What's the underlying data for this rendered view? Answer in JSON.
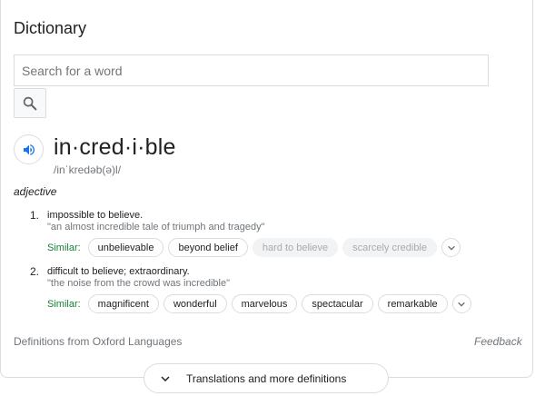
{
  "title": "Dictionary",
  "search": {
    "placeholder": "Search for a word"
  },
  "entry": {
    "word": "in·cred·i·ble",
    "phonetic": "/inˈkredəb(ə)l/",
    "part_of_speech": "adjective",
    "definitions": [
      {
        "number": "1.",
        "text": "impossible to believe.",
        "example": "\"an almost incredible tale of triumph and tragedy\"",
        "similar_label": "Similar:",
        "similar": [
          "unbelievable",
          "beyond belief",
          "hard to believe",
          "scarcely credible"
        ]
      },
      {
        "number": "2.",
        "text": "difficult to believe; extraordinary.",
        "example": "\"the noise from the crowd was incredible\"",
        "similar_label": "Similar:",
        "similar": [
          "magnificent",
          "wonderful",
          "marvelous",
          "spectacular",
          "remarkable"
        ]
      }
    ]
  },
  "footer": {
    "source": "Definitions from Oxford Languages",
    "feedback": "Feedback"
  },
  "more_button": {
    "label": "Translations and more definitions"
  },
  "colors": {
    "accent": "#1a73e8",
    "similar_label": "#188038",
    "muted": "#70757a",
    "border": "#dadce0"
  },
  "icons": {
    "search": "search-icon",
    "audio": "speaker-icon",
    "expand": "chevron-down-icon"
  }
}
